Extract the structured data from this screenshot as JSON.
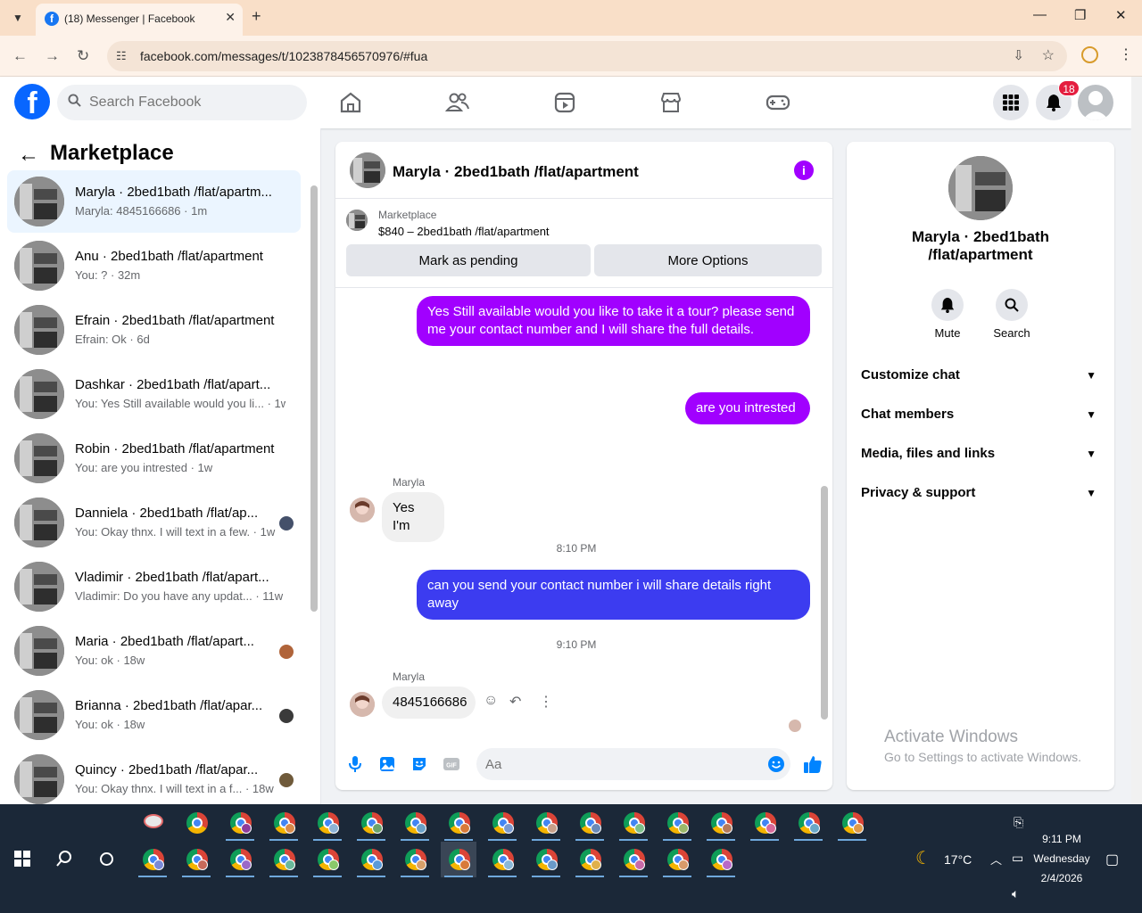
{
  "browser": {
    "tab_title": "(18) Messenger | Facebook",
    "url": "facebook.com/messages/t/1023878456570976/#fua"
  },
  "fb": {
    "search_placeholder": "Search Facebook",
    "notifications_count": "18"
  },
  "left_panel": {
    "title": "Marketplace",
    "conversations": [
      {
        "name": "Maryla · 2bed1bath /flat/apartm...",
        "preview": "Maryla: 4845166686 · 1m"
      },
      {
        "name": "Anu · 2bed1bath /flat/apartment",
        "preview": "You: ? · 32m"
      },
      {
        "name": "Efrain · 2bed1bath /flat/apartment",
        "preview": "Efrain: Ok · 6d"
      },
      {
        "name": "Dashkar · 2bed1bath /flat/apart...",
        "preview": "You: Yes Still available would you li... · 1w"
      },
      {
        "name": "Robin · 2bed1bath /flat/apartment",
        "preview": "You: are you intrested · 1w"
      },
      {
        "name": "Danniela · 2bed1bath /flat/ap...",
        "preview": "You: Okay thnx. I will text in a few. · 1w"
      },
      {
        "name": "Vladimir · 2bed1bath /flat/apart...",
        "preview": "Vladimir: Do you have any updat... · 11w"
      },
      {
        "name": "Maria · 2bed1bath /flat/apart...",
        "preview": "You: ok · 18w"
      },
      {
        "name": "Brianna · 2bed1bath /flat/apar...",
        "preview": "You: ok · 18w"
      },
      {
        "name": "Quincy · 2bed1bath /flat/apar...",
        "preview": "You: Okay thnx. I will text in a f... · 18w"
      }
    ]
  },
  "chat": {
    "header_name": "Maryla · 2bed1bath /flat/apartment",
    "listing_source": "Marketplace",
    "listing_price": "$840 – 2bed1bath /flat/apartment",
    "btn_pending": "Mark as pending",
    "btn_more": "More Options",
    "messages": {
      "m1": "Yes Still available would you like to take it a tour? please send me your contact number and I will share the full details.",
      "m2": "are you  intrested",
      "sender1": "Maryla",
      "m3": "Yes I'm",
      "time1": "8:10 PM",
      "m4": "can you send your contact number i will share details right away",
      "time2": "9:10 PM",
      "sender2": "Maryla",
      "m5": "4845166686"
    },
    "composer_placeholder": "Aa"
  },
  "right_panel": {
    "name": "Maryla · 2bed1bath /flat/apartment",
    "mute": "Mute",
    "search": "Search",
    "rows": [
      "Customize chat",
      "Chat members",
      "Media, files and links",
      "Privacy & support"
    ],
    "activate_title": "Activate Windows",
    "activate_sub": "Go to Settings to activate Windows."
  },
  "taskbar": {
    "weather": "17°C",
    "time": "9:11 PM",
    "day": "Wednesday",
    "date": "2/4/2026"
  },
  "colors": {
    "outgoing": "#a100ff",
    "outgoing_blue": "#3c3cf0",
    "fb_blue": "#0866ff"
  }
}
